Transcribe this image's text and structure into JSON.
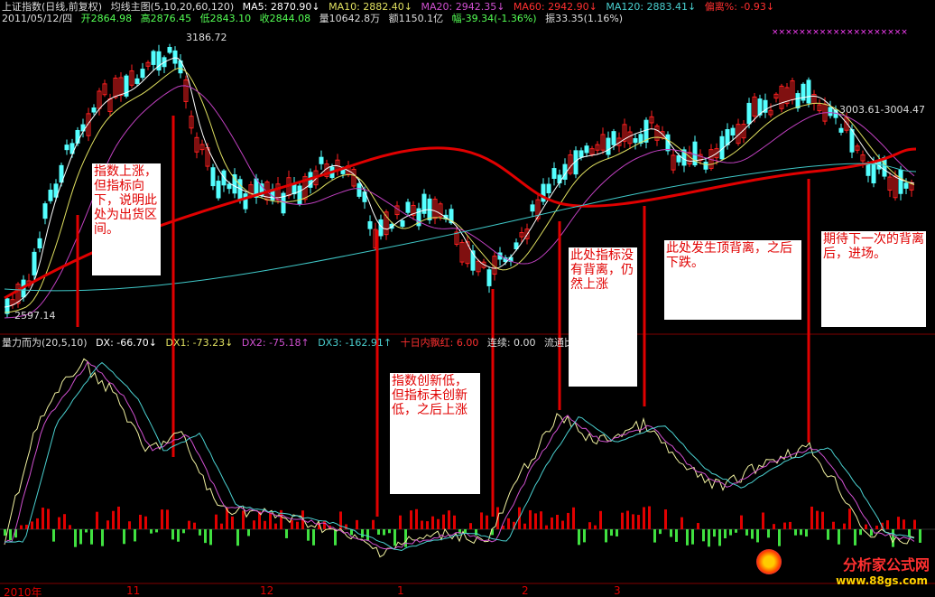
{
  "header": {
    "line1": {
      "index": "上证指数(日线,前复权)",
      "main_label": "均线主图(5,10,20,60,120)",
      "ma5": "MA5: 2870.90↓",
      "ma10": "MA10: 2882.40↓",
      "ma20": "MA20: 2942.35↓",
      "ma60": "MA60: 2942.90↓",
      "ma120": "MA120: 2883.41↓",
      "pianli": "偏离%: -0.93↓"
    },
    "line2": {
      "date": "2011/05/12/四",
      "open": "开2864.98",
      "high": "高2876.45",
      "low": "低2843.10",
      "close": "收2844.08",
      "volume": "量10642.8万",
      "amount": "额1150.1亿",
      "change": "幅-39.34(-1.36%)",
      "amplitude": "振33.35(1.16%)"
    }
  },
  "price_labels": {
    "high": "3186.72",
    "low": "2597.14",
    "right": "3003.61-3004.47"
  },
  "indicator_header": {
    "name": "量力而为(20,5,10)",
    "dx": "DX: -66.70↓",
    "dx1": "DX1: -73.23↓",
    "dx2": "DX2: -75.18↑",
    "dx3": "DX3: -162.91↑",
    "tenday": "十日内飘红: 6.00",
    "lianxu": "连续: 0.00",
    "liutong": "流通比:"
  },
  "notes": [
    {
      "text": "指数上涨，但指标向下，说明此处为出货区间。"
    },
    {
      "text": "指数创新低，但指标未创新低，之后上涨"
    },
    {
      "text": "此处指标没有背离，仍然上涨"
    },
    {
      "text": "此处发生顶背离，之后下跌。"
    },
    {
      "text": "期待下一次的背离后，进场。"
    }
  ],
  "x_axis": [
    "2010年",
    "11",
    "12",
    "1",
    "2",
    "3"
  ],
  "watermark": {
    "brand": "分析家公式网",
    "url": "www.88gs.com"
  },
  "colors": {
    "up": "#ff2020",
    "down": "#54ffff",
    "ma120": "#e00000",
    "ma60": "#3fc8c8",
    "ma20": "#c040c0",
    "ma10": "#e0e060",
    "ma5": "#ffffff"
  }
}
